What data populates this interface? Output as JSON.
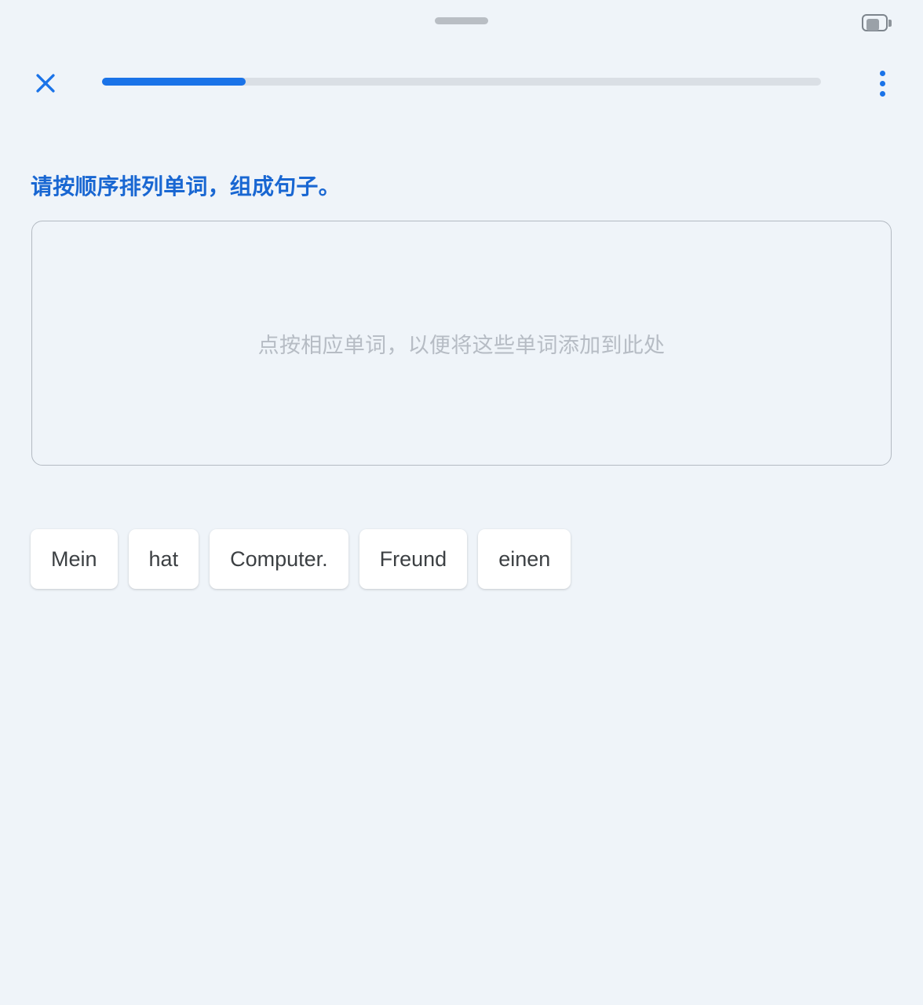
{
  "status_bar": {
    "drag_handle": "drag-handle",
    "battery": {
      "icon": "battery-icon",
      "level_percent": 62
    }
  },
  "top_nav": {
    "close_label": "×",
    "close_icon": "close-icon",
    "menu_icon": "more-vert-icon",
    "progress": {
      "percent": 20,
      "fill_color": "#1a73e8",
      "track_color": "#dadfe5"
    }
  },
  "exercise": {
    "prompt": "请按顺序排列单词，组成句子。",
    "prompt_color": "#1967d2",
    "answer_area": {
      "placeholder": "点按相应单词，以便将这些单词添加到此处",
      "placeholder_color": "#b6bcc4",
      "selected_words": []
    },
    "word_bank": [
      {
        "label": "Mein"
      },
      {
        "label": "hat"
      },
      {
        "label": "Computer."
      },
      {
        "label": "Freund"
      },
      {
        "label": "einen"
      }
    ]
  },
  "theme": {
    "background": "#eff4f9",
    "accent": "#1a73e8",
    "chip_background": "#ffffff",
    "chip_text": "#3c4043",
    "border": "#b3bac2"
  }
}
